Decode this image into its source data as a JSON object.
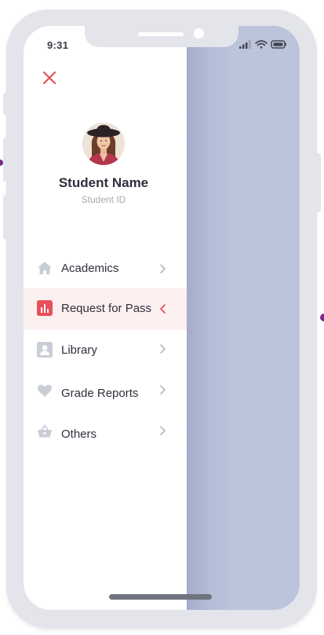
{
  "status_bar": {
    "time": "9:31"
  },
  "profile": {
    "name": "Student Name",
    "id_label": "Student ID"
  },
  "menu": {
    "items": [
      {
        "label": "Academics",
        "icon": "home-icon",
        "active": false
      },
      {
        "label": "Request for Pass",
        "icon": "bar-chart-icon",
        "active": true
      },
      {
        "label": "Library",
        "icon": "person-card-icon",
        "active": false
      },
      {
        "label": "Grade Reports",
        "icon": "heart-icon",
        "active": false
      },
      {
        "label": "Others",
        "icon": "basket-icon",
        "active": false
      }
    ]
  },
  "colors": {
    "accent": "#e8505b",
    "active_bg": "#fdf0f1",
    "icon_inactive": "#c9cdd6",
    "backdrop": "#bcc4dc",
    "frame": "#e3e5ea"
  }
}
